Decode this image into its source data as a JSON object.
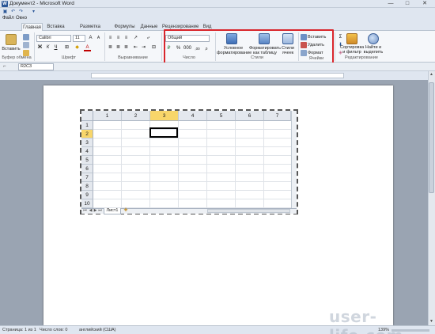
{
  "window": {
    "title": "Документ2 - Microsoft Word",
    "minimize": "—",
    "maximize": "□",
    "close": "✕"
  },
  "menu": {
    "file": "Файл",
    "window": "Окно"
  },
  "tabs": [
    "Главная",
    "Вставка",
    "Разметка страницы",
    "Формулы",
    "Данные",
    "Рецензирование",
    "Вид"
  ],
  "ribbon": {
    "paste_label": "Вставить",
    "font_name": "Calibri",
    "font_size": "11",
    "number_format": "Общий",
    "conditional_formatting": [
      "Условное",
      "форматирование"
    ],
    "format_as_table": [
      "Форматировать",
      "как таблицу"
    ],
    "cell_styles": [
      "Стили",
      "ячеек"
    ],
    "insert": "Вставить",
    "delete": "Удалить",
    "format": "Формат",
    "sort_filter": [
      "Сортировка",
      "и фильтр"
    ],
    "find_select": [
      "Найти и",
      "выделить"
    ],
    "groups": {
      "clipboard": "Буфер обмена",
      "font": "Шрифт",
      "alignment": "Выравнивание",
      "number": "Число",
      "styles": "Стили",
      "cells": "Ячейки",
      "editing": "Редактирование"
    }
  },
  "name_box": "R2C3",
  "sheet": {
    "columns": [
      "1",
      "2",
      "3",
      "4",
      "5",
      "6",
      "7"
    ],
    "rows": [
      "1",
      "2",
      "3",
      "4",
      "5",
      "6",
      "7",
      "8",
      "9",
      "10"
    ],
    "selected_column": "3",
    "selected_row": "2",
    "tab_name": "Лист1"
  },
  "status": {
    "page": "Страница: 1 из 1",
    "words": "Число слов: 0",
    "language": "английский (США)",
    "zoom": "139%"
  },
  "watermark": "user-life.com"
}
